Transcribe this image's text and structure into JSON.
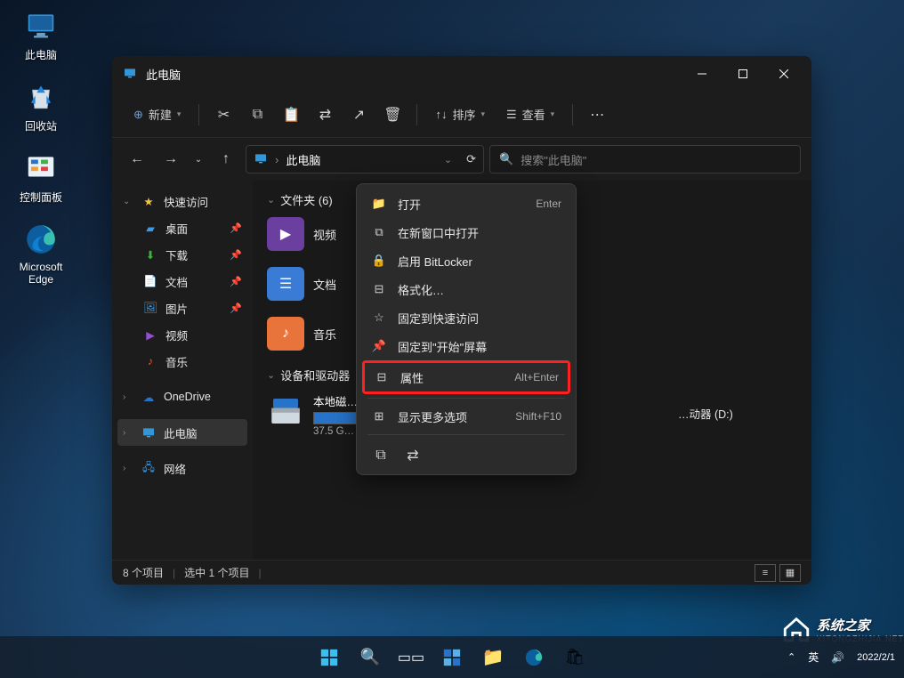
{
  "desktop_icons": [
    {
      "name": "this-pc",
      "label": "此电脑"
    },
    {
      "name": "recycle-bin",
      "label": "回收站"
    },
    {
      "name": "control-panel",
      "label": "控制面板"
    },
    {
      "name": "edge",
      "label": "Microsoft Edge"
    }
  ],
  "window": {
    "title": "此电脑",
    "toolbar": {
      "new": "新建",
      "sort": "排序",
      "view": "查看"
    },
    "address": {
      "location": "此电脑"
    },
    "search": {
      "placeholder": "搜索\"此电脑\""
    }
  },
  "sidebar": {
    "quick_access": "快速访问",
    "items": [
      {
        "label": "桌面",
        "pinned": true
      },
      {
        "label": "下载",
        "pinned": true
      },
      {
        "label": "文档",
        "pinned": true
      },
      {
        "label": "图片",
        "pinned": true
      },
      {
        "label": "视频",
        "pinned": false
      },
      {
        "label": "音乐",
        "pinned": false
      }
    ],
    "onedrive": "OneDrive",
    "this_pc": "此电脑",
    "network": "网络"
  },
  "content": {
    "folders_header": "文件夹 (6)",
    "folders": [
      {
        "label": "视频",
        "bg": "#6b3fa0"
      },
      {
        "label": "文档",
        "bg": "#3a7bd5"
      },
      {
        "label": "音乐",
        "bg": "#e8743b"
      }
    ],
    "drives_header": "设备和驱动器",
    "drives": [
      {
        "label": "本地磁…",
        "size": "37.5 G…",
        "fill": 48
      },
      {
        "label": "…动器 (D:)",
        "size": "",
        "fill": 0
      }
    ]
  },
  "context_menu": {
    "items": [
      {
        "label": "打开",
        "shortcut": "Enter",
        "icon": "folder-icon"
      },
      {
        "label": "在新窗口中打开",
        "shortcut": "",
        "icon": "new-window-icon"
      },
      {
        "label": "启用 BitLocker",
        "shortcut": "",
        "icon": "lock-icon"
      },
      {
        "label": "格式化…",
        "shortcut": "",
        "icon": "format-icon"
      },
      {
        "label": "固定到快速访问",
        "shortcut": "",
        "icon": "pin-star-icon"
      },
      {
        "label": "固定到\"开始\"屏幕",
        "shortcut": "",
        "icon": "pin-icon"
      },
      {
        "label": "属性",
        "shortcut": "Alt+Enter",
        "icon": "properties-icon",
        "highlight": true
      },
      {
        "label": "显示更多选项",
        "shortcut": "Shift+F10",
        "icon": "more-icon"
      }
    ]
  },
  "statusbar": {
    "items": "8 个项目",
    "selected": "选中 1 个项目"
  },
  "tray": {
    "ime": "英",
    "date": "2022/2/1"
  },
  "watermark": {
    "brand": "系统之家",
    "url": "XITONGZHIJIA.NET"
  }
}
